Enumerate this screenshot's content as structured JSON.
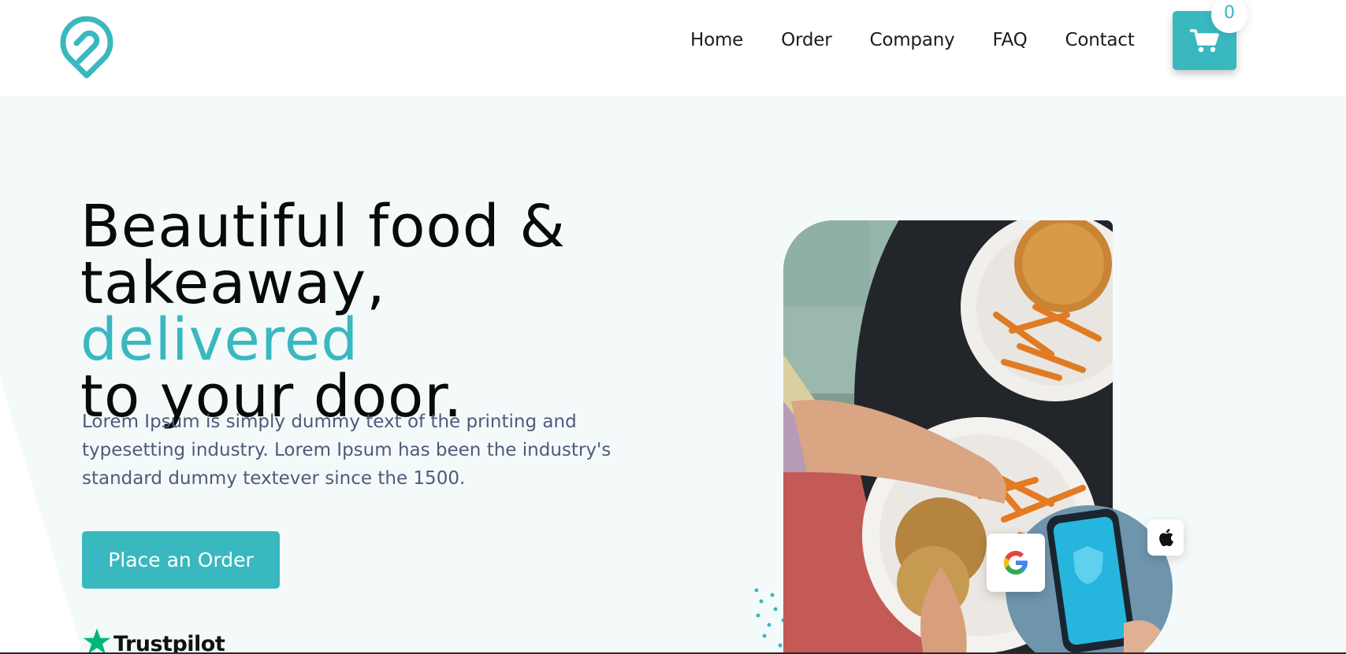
{
  "header": {
    "nav": [
      "Home",
      "Order",
      "Company",
      "FAQ",
      "Contact"
    ],
    "cart_count": "0"
  },
  "hero": {
    "title_line1": "Beautiful food &",
    "title_line2_plain": "takeaway, ",
    "title_line2_accent": "delivered",
    "title_line3": "to your door.",
    "description": "Lorem Ipsum is simply dummy text of the printing and typesetting industry. Lorem Ipsum has been the industry's standard dummy textever since the 1500.",
    "cta_label": "Place an Order",
    "trustpilot_label": "Trustpilot"
  },
  "icons": {
    "logo": "location-pin-logo-icon",
    "cart": "shopping-cart-icon",
    "google": "google-icon",
    "apple": "apple-icon",
    "star": "trustpilot-star-icon"
  },
  "colors": {
    "accent": "#3ab8bf",
    "hero_background": "#f4fafa",
    "title_text": "#0a0a0a",
    "body_text": "#4f5a7a",
    "trustpilot_green": "#00b67a"
  }
}
